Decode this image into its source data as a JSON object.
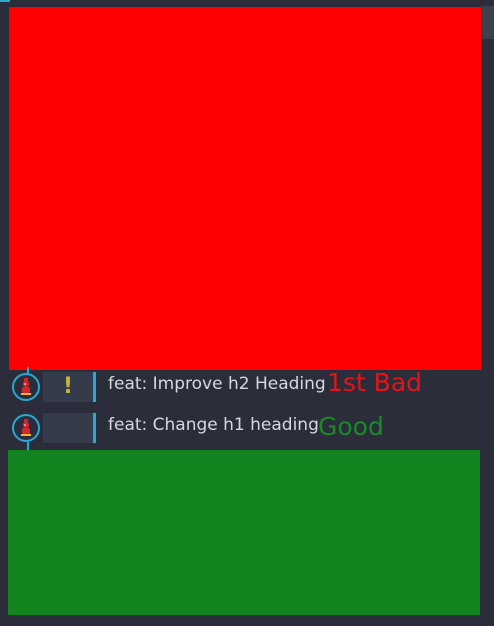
{
  "commits": [
    {
      "status_glyph": "!",
      "message": "feat: Improve h2 Heading",
      "tag": "1st Bad"
    },
    {
      "status_glyph": "",
      "message": "feat: Change h1 heading",
      "tag": "Good"
    }
  ],
  "colors": {
    "bad_panel": "#ff0000",
    "good_panel": "#138320",
    "bad_tag": "#e3141a",
    "good_tag": "#1a8a26",
    "accent": "#29a9d6",
    "background": "#2b2e3a"
  },
  "icons": {
    "avatar": "author-avatar-icon",
    "status": "warning-icon"
  }
}
